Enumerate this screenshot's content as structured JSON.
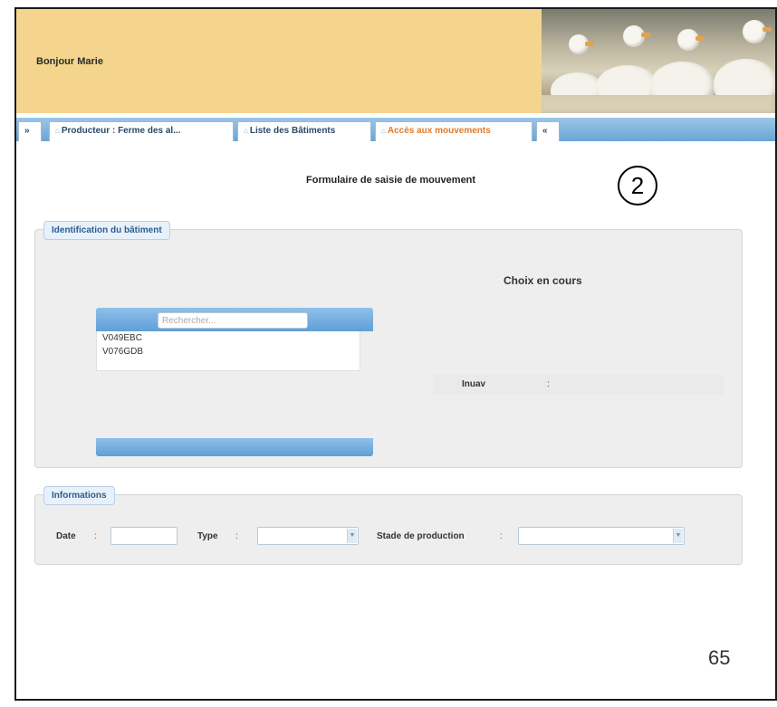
{
  "header": {
    "greeting": "Bonjour Marie"
  },
  "tabs": [
    {
      "icon": "»",
      "label": ""
    },
    {
      "icon": "⌂",
      "label": "Producteur : Ferme des al..."
    },
    {
      "icon": "⌂",
      "label": "Liste des Bâtiments"
    },
    {
      "icon": "⌂",
      "label": "Accès aux mouvements",
      "active": true
    },
    {
      "icon": "«",
      "label": ""
    }
  ],
  "form": {
    "title": "Formulaire de saisie de mouvement"
  },
  "step_badge": "2",
  "identification": {
    "legend": "Identification du bâtiment",
    "search_placeholder": "Rechercher...",
    "items": [
      "V049EBC",
      "V076GDB"
    ],
    "choice_title": "Choix en cours",
    "inuav_label": "Inuav",
    "inuav_colon": ":"
  },
  "informations": {
    "legend": "Informations",
    "date_label": "Date",
    "type_label": "Type",
    "stade_label": "Stade de production",
    "colon": ":",
    "date_value": "",
    "type_value": "",
    "stade_value": ""
  },
  "page_number": "65",
  "colors": {
    "header_bg": "#f5d58e",
    "tab_bar": "#6aa5d5",
    "active_tab_text": "#e07a2a",
    "legend_text": "#2d5d8e"
  }
}
